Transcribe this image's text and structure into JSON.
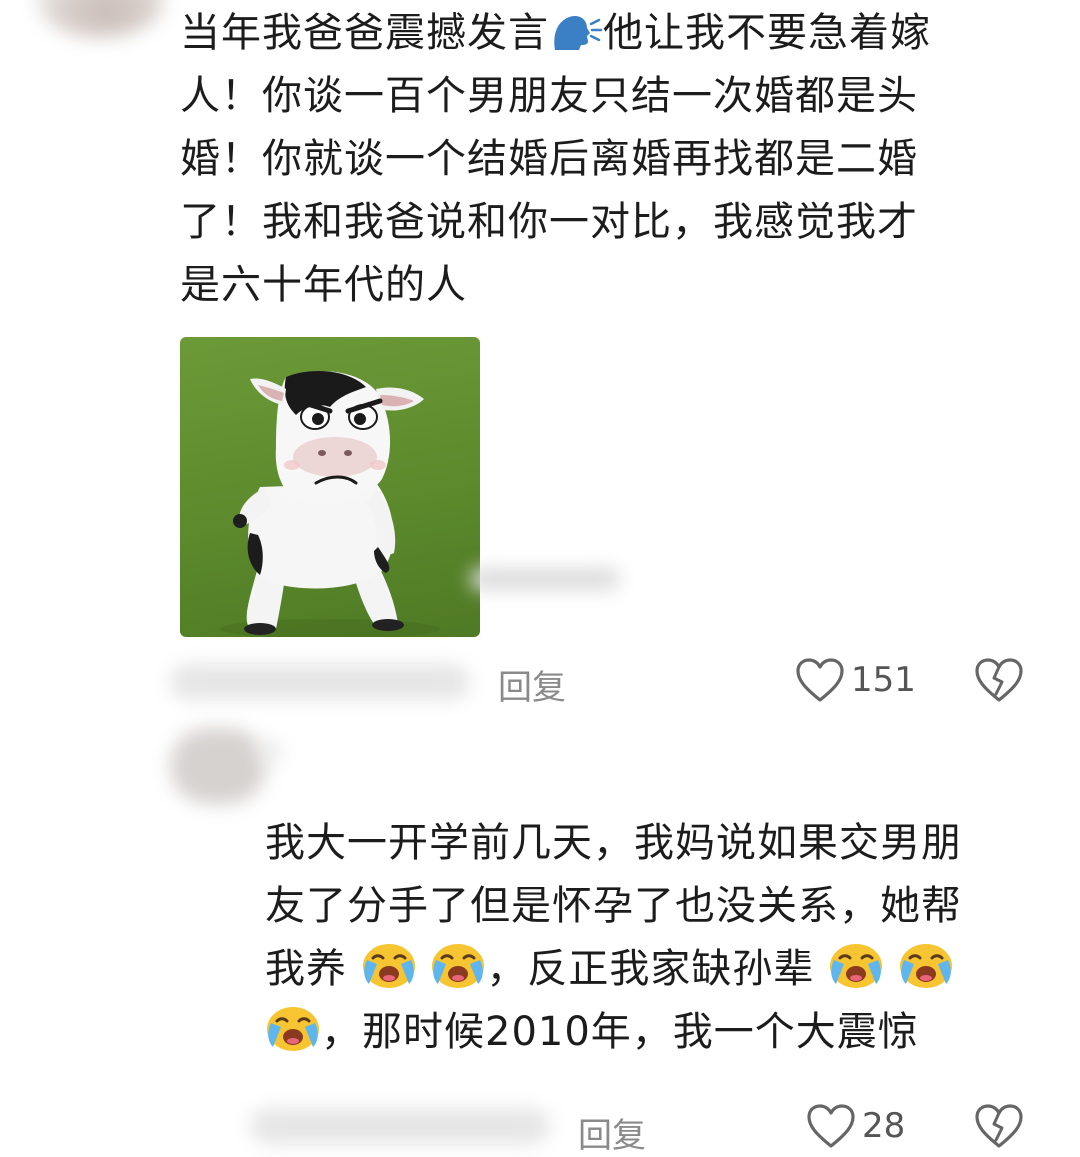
{
  "comment1": {
    "lines": [
      "当年我爸爸震撼发言",
      "他让我不要急着嫁",
      "人！你谈一百个男朋友只结一次婚都是头",
      "婚！你就谈一个结婚后离婚再找都是二婚",
      "了！我和我爸说和你一对比，我感觉我才",
      "是六十年代的人"
    ],
    "reply_label": "回复",
    "likes": "151"
  },
  "comment2": {
    "lines": [
      "我大一开学前几天，我妈说如果交男朋",
      "友了分手了但是怀孕了也没关系，她帮",
      "我养",
      "，反正我家缺孙辈",
      "，那时候2010年，我一个大震惊"
    ],
    "reply_label": "回复",
    "likes": "28"
  },
  "icons": {
    "speaking_head": "speaking-head-emoji",
    "crying_laughing": "loudly-crying-emoji",
    "like": "heart-outline-icon",
    "dislike": "broken-heart-icon"
  },
  "colors": {
    "text": "#1c1c1c",
    "reply": "#8a8a8a",
    "sticker_bg": "#5c8a2c"
  }
}
